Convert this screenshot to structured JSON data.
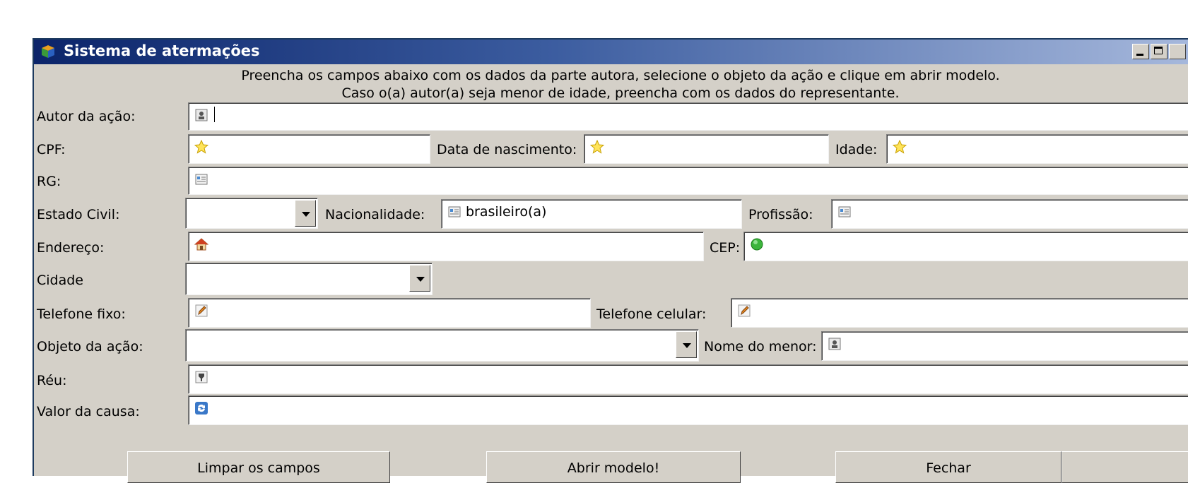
{
  "window": {
    "title": "Sistema de atermações"
  },
  "instructions": {
    "line1": "Preencha os campos abaixo com os dados da parte autora, selecione o objeto da ação e clique em abrir modelo.",
    "line2": "Caso o(a) autor(a) seja menor de idade, preencha com os dados do representante."
  },
  "form": {
    "autor_label": "Autor da ação:",
    "cpf_label": "CPF:",
    "nascimento_label": "Data de nascimento:",
    "idade_label": "Idade:",
    "rg_label": "RG:",
    "estado_civil_label": "Estado Civil:",
    "nacionalidade_label": "Nacionalidade:",
    "nacionalidade_value": "brasileiro(a)",
    "profissao_label": "Profissão:",
    "endereco_label": "Endereço:",
    "cep_label": "CEP:",
    "cidade_label": "Cidade",
    "telefone_fixo_label": "Telefone fixo:",
    "telefone_celular_label": "Telefone celular:",
    "objeto_label": "Objeto da ação:",
    "nome_menor_label": "Nome do menor:",
    "reu_label": "Réu:",
    "valor_label": "Valor da causa:"
  },
  "buttons": {
    "limpar": "Limpar os campos",
    "abrir": "Abrir modelo!",
    "fechar": "Fechar"
  },
  "icons": {
    "app": "cube-icon",
    "person": "person-card-icon",
    "star": "star-icon",
    "id_card": "id-card-icon",
    "home": "house-icon",
    "cep": "green-circle-icon",
    "phone": "pencil-icon",
    "defendant": "badge-icon",
    "money": "refresh-icon"
  }
}
